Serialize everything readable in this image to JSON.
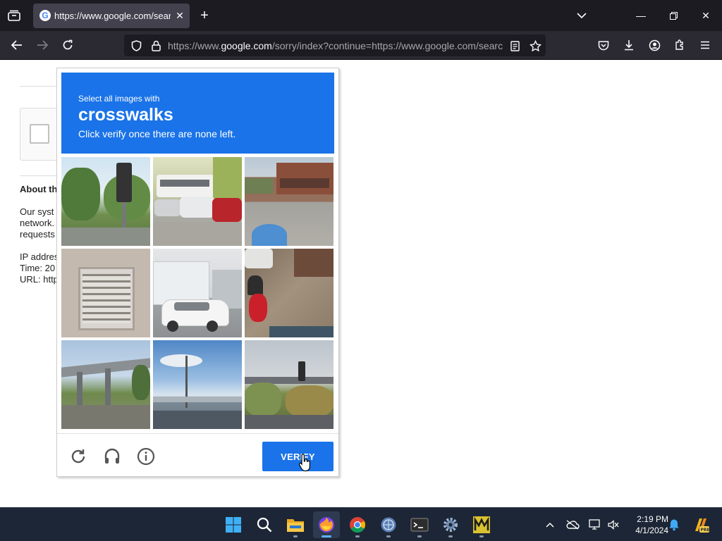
{
  "browser": {
    "tab": {
      "title": "https://www.google.com/search",
      "favicon": "google-g-icon"
    },
    "url": {
      "prefix": "https://www.",
      "host": "google.com",
      "rest": "/sorry/index?continue=https://www.google.com/search"
    }
  },
  "background_page": {
    "heading": "About th",
    "lines": [
      "Our syst",
      "network.",
      "requests",
      "IP addres",
      "Time: 20",
      "URL: http"
    ]
  },
  "captcha": {
    "instruction_line1": "Select all images with",
    "target": "crosswalks",
    "instruction_line2": "Click verify once there are none left.",
    "verify_label": "VERIFY",
    "colors": {
      "header": "#1a73e8",
      "button": "#1a73e8"
    },
    "tiles": [
      {
        "name": "traffic-light-trees"
      },
      {
        "name": "parked-cars-bus"
      },
      {
        "name": "street-buildings"
      },
      {
        "name": "window-shutter"
      },
      {
        "name": "white-car-building"
      },
      {
        "name": "scooter-rider-street"
      },
      {
        "name": "highway-bridge"
      },
      {
        "name": "highway-sky"
      },
      {
        "name": "traffic-light-intersection"
      }
    ]
  },
  "taskbar": {
    "time": "2:19 PM",
    "date": "4/1/2024",
    "apps": [
      "start-icon",
      "search-icon",
      "file-explorer-icon",
      "firefox-icon",
      "chrome-icon",
      "browser-icon",
      "terminal-icon",
      "settings-icon",
      "app-m-icon"
    ]
  }
}
